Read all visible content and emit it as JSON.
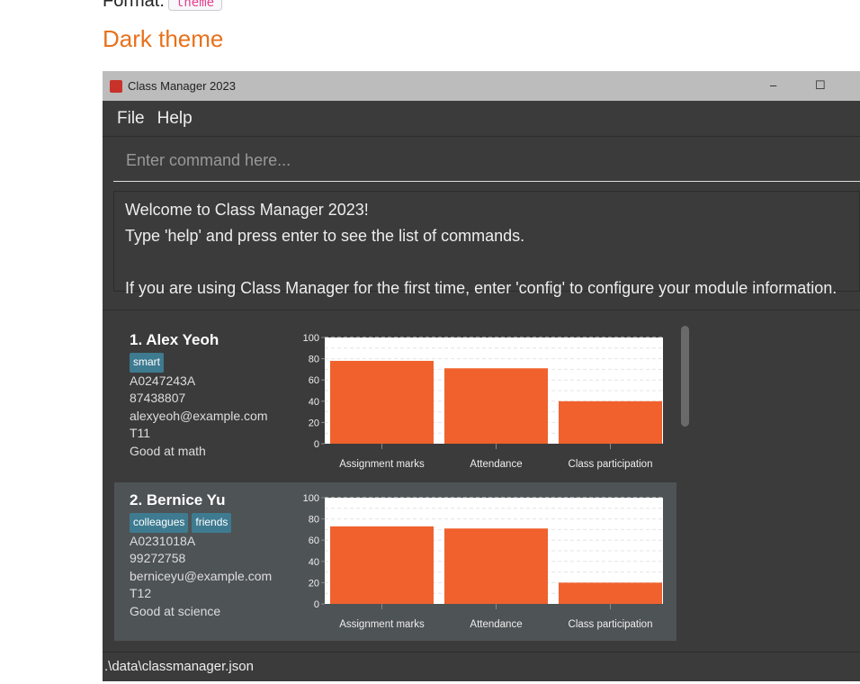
{
  "doc": {
    "format_label": "Format:",
    "format_code": "theme",
    "heading": "Dark theme"
  },
  "window": {
    "title": "Class Manager 2023",
    "minimize": "–",
    "maximize": "☐"
  },
  "menu": [
    "File",
    "Help"
  ],
  "command": {
    "placeholder": "Enter command here..."
  },
  "result": [
    "Welcome to Class Manager 2023!",
    "Type 'help' and press enter to see the list of commands.",
    "",
    "If you are using Class Manager for the first time, enter 'config' to configure your module information."
  ],
  "students": [
    {
      "name": "1.  Alex Yeoh",
      "tags": [
        "smart"
      ],
      "id": "A0247243A",
      "phone": "87438807",
      "email": "alexyeoh@example.com",
      "tutorial": "T11",
      "comment": "Good at math"
    },
    {
      "name": "2.  Bernice Yu",
      "tags": [
        "colleagues",
        "friends"
      ],
      "id": "A0231018A",
      "phone": "99272758",
      "email": "berniceyu@example.com",
      "tutorial": "T12",
      "comment": "Good at science"
    }
  ],
  "chart_data": [
    {
      "type": "bar",
      "categories": [
        "Assignment marks",
        "Attendance",
        "Class participation"
      ],
      "values": [
        78,
        71,
        40
      ],
      "ylim": [
        0,
        100
      ],
      "yticks": [
        "0",
        "20",
        "40",
        "60",
        "80",
        "100"
      ]
    },
    {
      "type": "bar",
      "categories": [
        "Assignment marks",
        "Attendance",
        "Class participation"
      ],
      "values": [
        73,
        71,
        20
      ],
      "ylim": [
        0,
        100
      ],
      "yticks": [
        "0",
        "20",
        "40",
        "60",
        "80",
        "100"
      ]
    }
  ],
  "status": ".\\data\\classmanager.json",
  "colors": {
    "bar": "#f0612d",
    "tag": "#3e7b91",
    "accent": "#e8711b"
  }
}
